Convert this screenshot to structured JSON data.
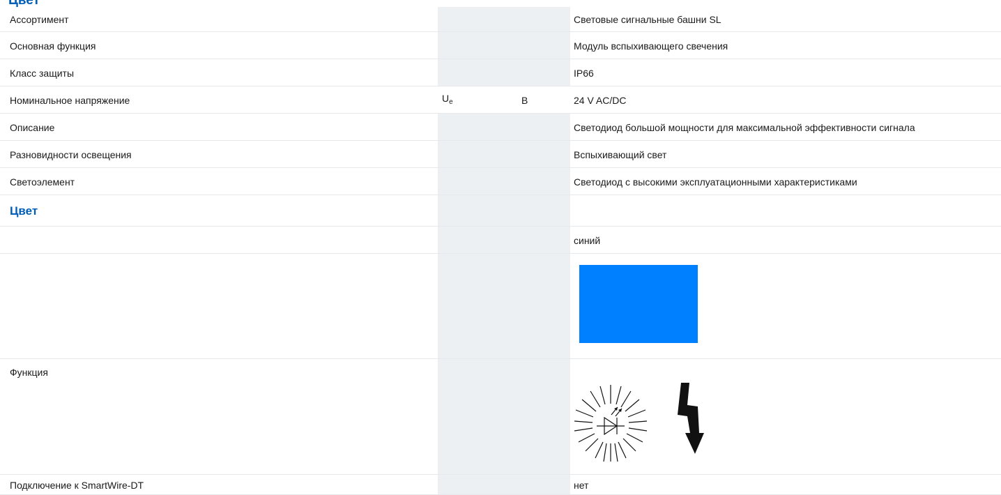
{
  "heading_clipped": "Цвет",
  "rows": [
    {
      "label": "Ассортимент",
      "symbol": "",
      "symbol_sub": "",
      "unit": "",
      "value": "Световые сигнальные башни SL"
    },
    {
      "label": "Основная функция",
      "symbol": "",
      "symbol_sub": "",
      "unit": "",
      "value": "Модуль вспыхивающего свечения"
    },
    {
      "label": "Класс защиты",
      "symbol": "",
      "symbol_sub": "",
      "unit": "",
      "value": "IP66"
    },
    {
      "label": "Номинальное напряжение",
      "symbol": "U",
      "symbol_sub": "e",
      "unit": "В",
      "value": "24 V AC/DC"
    },
    {
      "label": "Описание",
      "symbol": "",
      "symbol_sub": "",
      "unit": "",
      "value": "Светодиод большой мощности для максимальной эффективности сигнала"
    },
    {
      "label": "Разновидности освещения",
      "symbol": "",
      "symbol_sub": "",
      "unit": "",
      "value": "Вспыхивающий свет"
    },
    {
      "label": "Светоэлемент",
      "symbol": "",
      "symbol_sub": "",
      "unit": "",
      "value": "Светодиод с высокими эксплуатационными характеристиками"
    }
  ],
  "color_section": {
    "heading": "Цвет",
    "color_name": "синий",
    "swatch_color": "#0080ff"
  },
  "function_row": {
    "label": "Функция",
    "icon": "flashing-led-lightning-icon"
  },
  "smartwire_row": {
    "label": "Подключение к SmartWire-DT",
    "value": "нет"
  }
}
